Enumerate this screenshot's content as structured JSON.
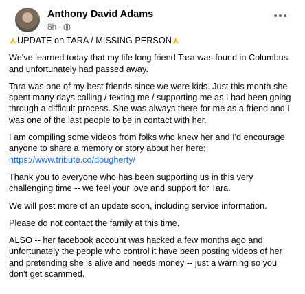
{
  "post": {
    "author": "Anthony David Adams",
    "time": "8h",
    "separator": "·",
    "privacy_icon": "globe-icon",
    "more_icon": "more-horizontal-icon",
    "headline_icon": "folded-hands-emoji",
    "headline": "UPDATE on TARA / MISSING PERSON",
    "paragraphs": [
      "We've learned today that my life long friend Tara was found in Columbus and unfortunately had passed away.",
      "Tara was one of my best friends since we were kids. Just this month she spent many days calling / texting me / supporting me as I had been going through a difficult process. She was always there for me as a friend and I was one of the last people to be in contact with her.",
      "I am compiling some videos from folks who knew her and I'd encourage anyone to share a memory or story about her here:",
      "Thank you to everyone who has been supporting us in this very challenging time -- we feel your love and support for Tara.",
      "We will post more of an update soon, including service information.",
      "Please do not contact the family at this time.",
      "ALSO -- her facebook account was hacked a few months ago and unfortunately the people who control it have been posting videos of her and pretending she is alive and needs money -- just a warning so you don't get scammed."
    ],
    "link": "https://www.tribute.co/dougherty/"
  },
  "colors": {
    "text": "#050505",
    "secondary": "#65676b",
    "link": "#216fdb"
  }
}
